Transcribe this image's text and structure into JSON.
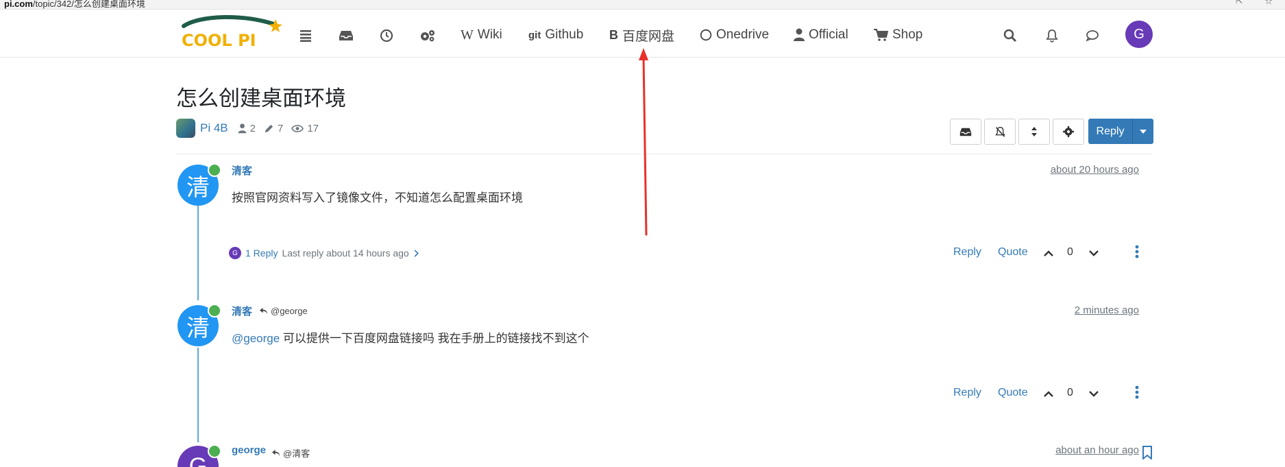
{
  "browser": {
    "url_host": "pi.com",
    "url_path": "/topic/342/怎么创建桌面环境"
  },
  "nav": {
    "logo_text": "COOL PI",
    "links": [
      {
        "icon": "W",
        "label": "Wiki"
      },
      {
        "icon": "git",
        "label": "Github"
      },
      {
        "icon": "B",
        "label": "百度网盘"
      },
      {
        "icon": "circle",
        "label": "Onedrive"
      },
      {
        "icon": "user",
        "label": "Official"
      },
      {
        "icon": "cart",
        "label": "Shop"
      }
    ],
    "user_initial": "G"
  },
  "topic": {
    "title": "怎么创建桌面环境",
    "category": "Pi 4B",
    "posters": "2",
    "posts": "7",
    "views": "17",
    "reply_button": "Reply"
  },
  "posts": [
    {
      "author": "清客",
      "avatar_char": "清",
      "avatar_color": "#2196f3",
      "time": "about 20 hours ago",
      "content": "按照官网资料写入了镜像文件，不知道怎么配置桌面环境",
      "replies_avatar": "G",
      "replies_count": "1 Reply",
      "replies_last": "Last reply about 14 hours ago",
      "reply": "Reply",
      "quote": "Quote",
      "votes": "0"
    },
    {
      "author": "清客",
      "avatar_char": "清",
      "avatar_color": "#2196f3",
      "parent": "@george",
      "time": "2 minutes ago",
      "mention": "@george",
      "content": " 可以提供一下百度网盘链接吗 我在手册上的链接找不到这个",
      "reply": "Reply",
      "quote": "Quote",
      "votes": "0"
    },
    {
      "author": "george",
      "avatar_char": "G",
      "avatar_color": "#673ab7",
      "parent": "@清客",
      "time": "about an hour ago"
    }
  ],
  "colors": {
    "accent": "#337ab7",
    "online": "#4caf50",
    "annotation_arrow": "#e8302a"
  }
}
